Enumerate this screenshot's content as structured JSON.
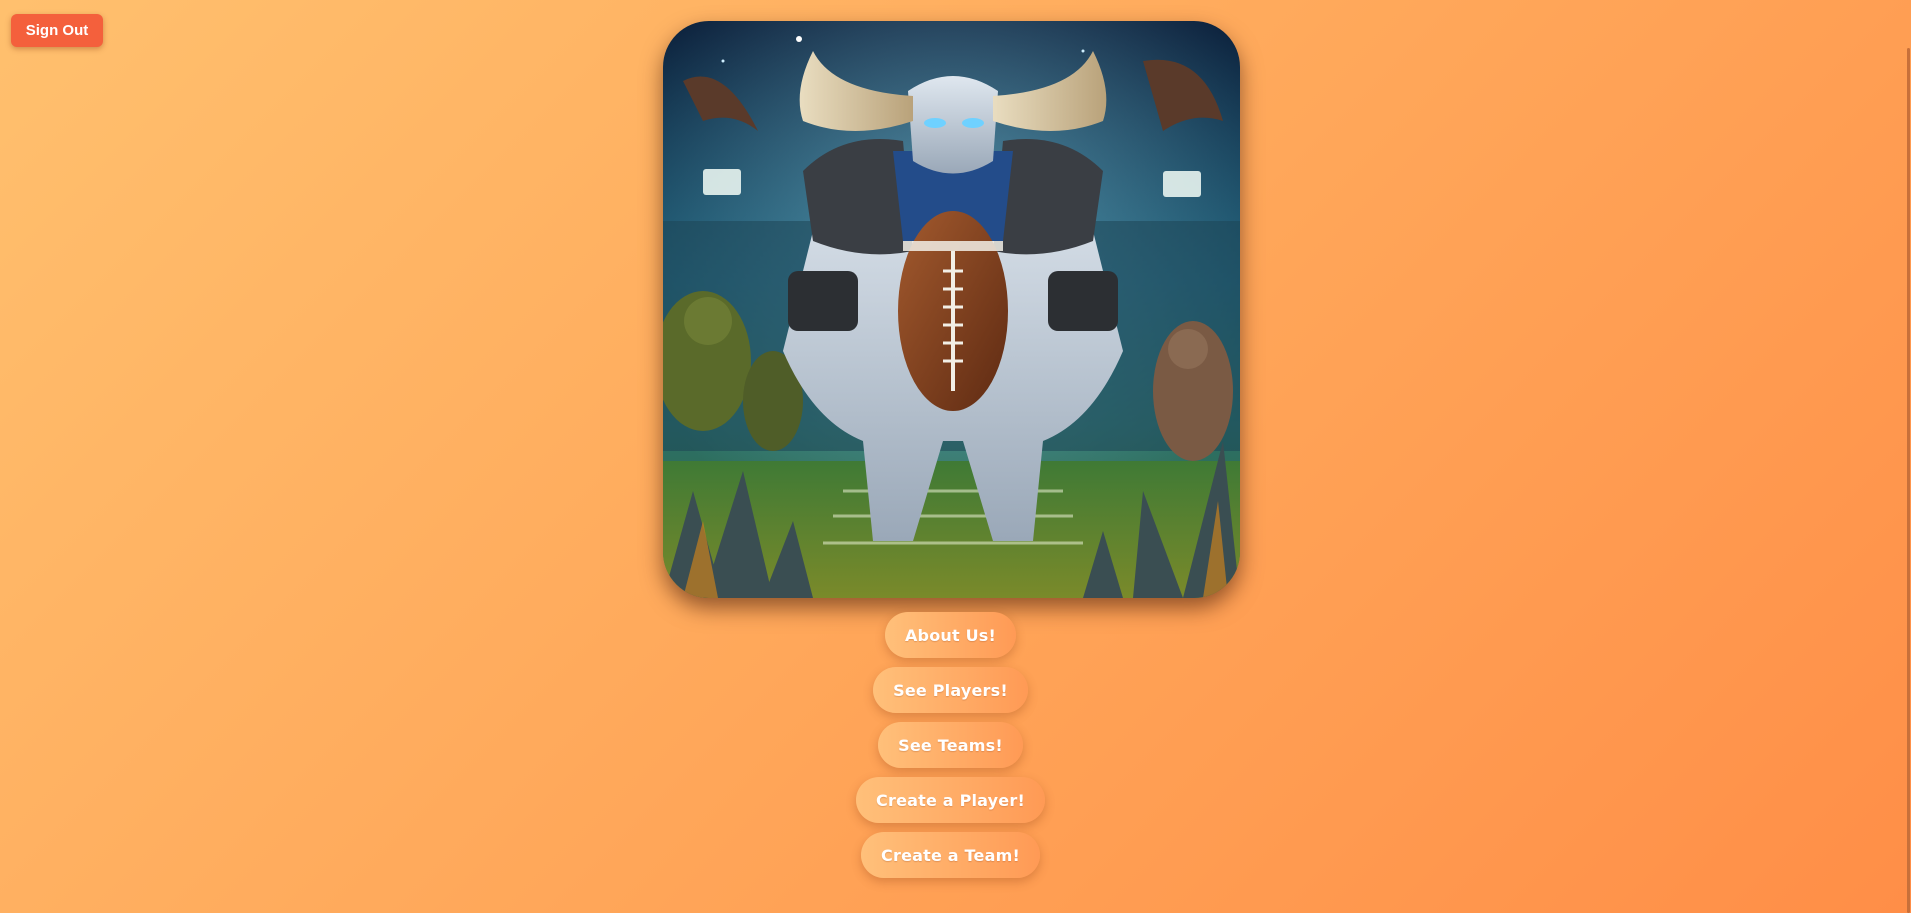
{
  "header": {
    "sign_out_label": "Sign Out"
  },
  "hero": {
    "image_description_icon": "minotaur-football-player-illustration"
  },
  "nav": {
    "buttons": [
      {
        "label": "About Us!"
      },
      {
        "label": "See Players!"
      },
      {
        "label": "See Teams!"
      },
      {
        "label": "Create a Player!"
      },
      {
        "label": "Create a Team!"
      }
    ]
  },
  "colors": {
    "background_start": "#ffc06e",
    "background_end": "#ff8e47",
    "sign_out": "#f4603c",
    "button_start": "#ffc07a",
    "button_end": "#ff9a55"
  }
}
